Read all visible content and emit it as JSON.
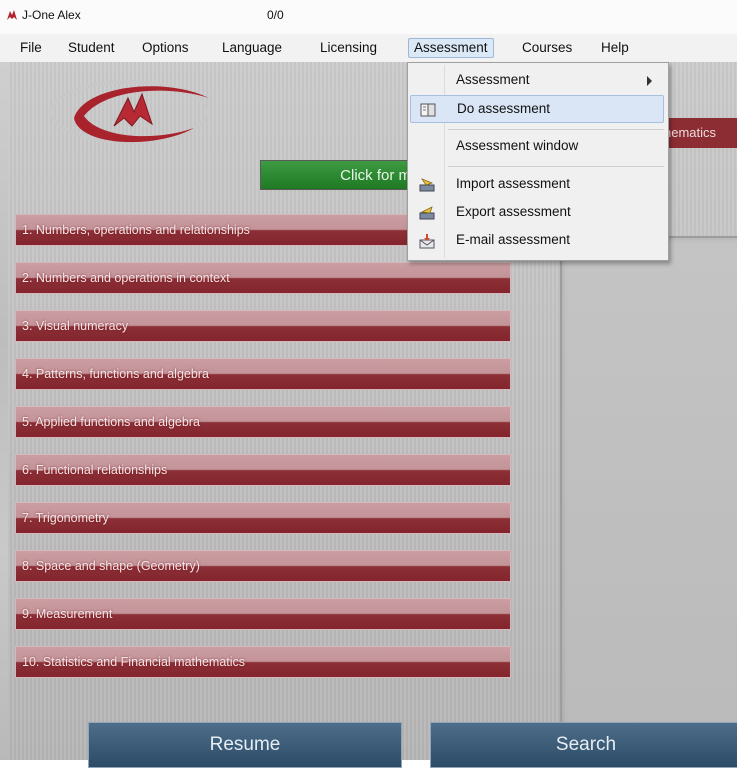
{
  "window": {
    "title": "J-One Alex",
    "counter": "0/0"
  },
  "menu": {
    "items": [
      {
        "label": "File"
      },
      {
        "label": "Student"
      },
      {
        "label": "Options"
      },
      {
        "label": "Language"
      },
      {
        "label": "Licensing"
      },
      {
        "label": "Assessment"
      },
      {
        "label": "Courses"
      },
      {
        "label": "Help"
      }
    ],
    "active": "Assessment"
  },
  "dropdown": {
    "items": [
      {
        "label": "Assessment",
        "submenu": true,
        "icon": "none"
      },
      {
        "label": "Do assessment",
        "icon": "book-icon",
        "highlighted": true
      },
      {
        "label": "Assessment window",
        "icon": "none"
      },
      {
        "label": "Import assessment",
        "icon": "import-icon"
      },
      {
        "label": "Export assessment",
        "icon": "export-icon"
      },
      {
        "label": "E-mail assessment",
        "icon": "email-icon"
      }
    ]
  },
  "main": {
    "more_button": "Click for m",
    "header_right": "hematics",
    "topics": [
      "1. Numbers, operations and relationships",
      "2. Numbers and operations in context",
      "3. Visual numeracy",
      "4. Patterns, functions and algebra",
      "5. Applied functions and algebra",
      "6. Functional relationships",
      "7. Trigonometry",
      "8. Space and shape (Geometry)",
      "9. Measurement",
      "10. Statistics and Financial mathematics"
    ],
    "resume_label": "Resume",
    "search_label": "Search"
  },
  "colors": {
    "topic_red": "#8d2f36",
    "accent_green": "#2a8a2e",
    "menu_highlight": "#dae6f5"
  }
}
